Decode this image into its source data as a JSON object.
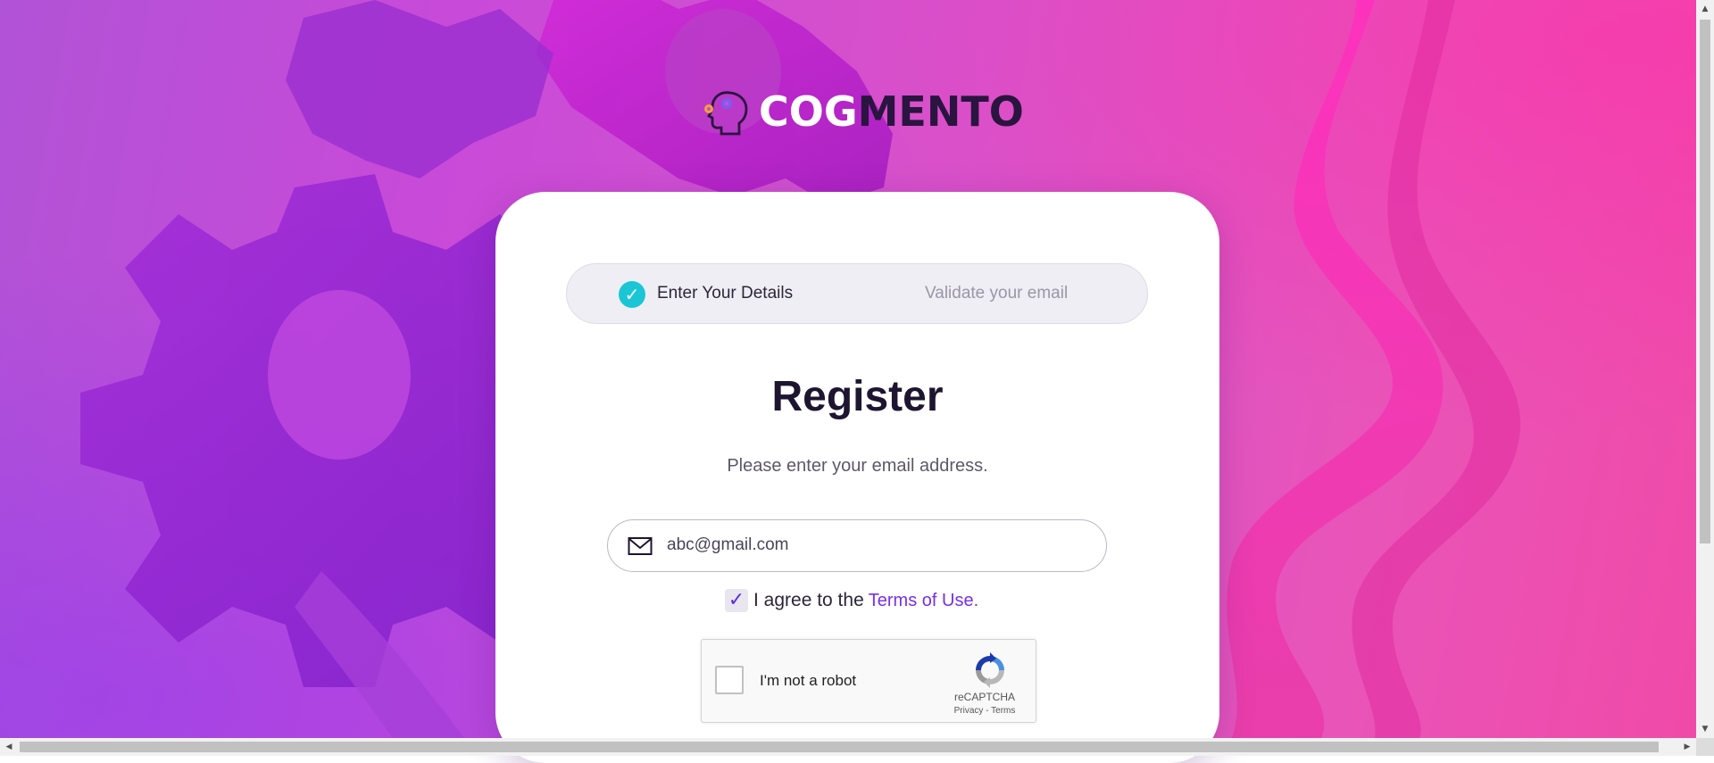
{
  "brand": {
    "logo_text_part1": "COG",
    "logo_text_part2": "MENTO",
    "icon": "head-gears-icon"
  },
  "steps": [
    {
      "label": "Enter Your Details",
      "status": "completed",
      "icon": "check-circle-icon"
    },
    {
      "label": "Validate your email",
      "status": "pending"
    }
  ],
  "form": {
    "title": "Register",
    "subtitle": "Please enter your email address.",
    "email": {
      "value": "abc@gmail.com",
      "icon": "mail-icon"
    },
    "terms": {
      "checked": true,
      "check_glyph": "✓",
      "text": "I agree to the",
      "link_text": "Terms of Use."
    }
  },
  "recaptcha": {
    "label": "I'm not a robot",
    "brand": "reCAPTCHA",
    "links": "Privacy - Terms"
  },
  "colors": {
    "accent": "#7a2ee6",
    "step_check": "#1ac6d6",
    "background_start": "#b153d6",
    "background_end": "#f04aa8"
  }
}
